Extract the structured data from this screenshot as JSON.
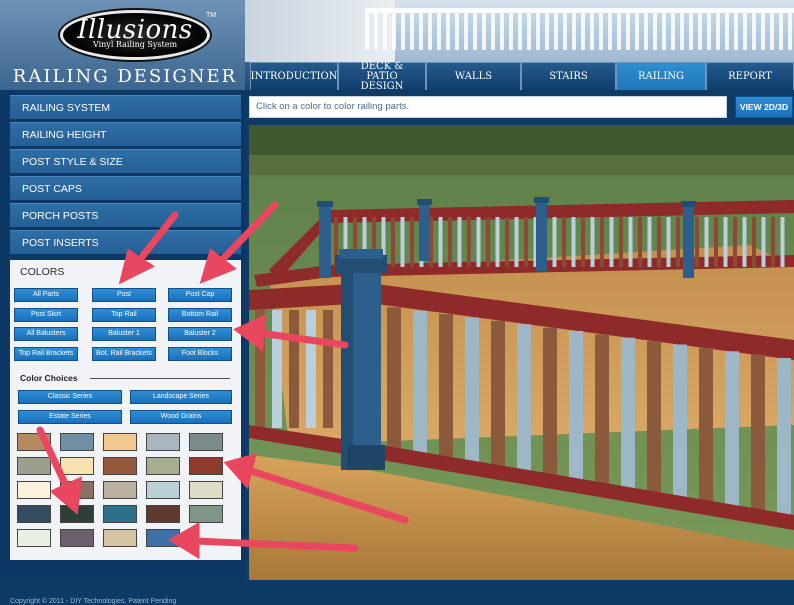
{
  "logo": {
    "title": "Illusions",
    "subtitle": "Vinyl Railing System",
    "tm": "TM"
  },
  "app_title": "RAILING DESIGNER",
  "tabs": [
    {
      "label": "INTRODUCTION"
    },
    {
      "label": "DECK & PATIO DESIGN"
    },
    {
      "label": "WALLS"
    },
    {
      "label": "STAIRS"
    },
    {
      "label": "RAILING"
    },
    {
      "label": "REPORT"
    }
  ],
  "active_tab": "RAILING",
  "sidebar": {
    "items": [
      {
        "label": "RAILING SYSTEM"
      },
      {
        "label": "RAILING HEIGHT"
      },
      {
        "label": "POST STYLE & SIZE"
      },
      {
        "label": "POST CAPS"
      },
      {
        "label": "PORCH POSTS"
      },
      {
        "label": "POST INSERTS"
      }
    ],
    "colors": {
      "heading": "COLORS",
      "parts": [
        "All Parts",
        "Post",
        "Post Cap",
        "Post Skirt",
        "Top Rail",
        "Bottom Rail",
        "All Balusters",
        "Baluster 1",
        "Baluster 2",
        "Top Rail Brackets",
        "Bot. Rail Brackets",
        "Foot Blocks"
      ],
      "choices_label": "Color Choices",
      "series": [
        "Classic Series",
        "Landscape Series",
        "Estate Series",
        "Wood Grains"
      ],
      "swatches": [
        "#b58a5e",
        "#6f8fa3",
        "#f4c98f",
        "#a8b6bf",
        "#7e8b8c",
        "#9aa08c",
        "#f8e2b0",
        "#97583c",
        "#a7ae8f",
        "#8c3b2c",
        "#fbf1dc",
        "#8a7164",
        "#b9b0a2",
        "#b9d1d4",
        "#dcdcc7",
        "#334c62",
        "#2f3e36",
        "#2e6f8d",
        "#5f3a2f",
        "#7f9586",
        "#e8efe3",
        "#6a5f6a",
        "#d4c4a4",
        "#3d6fa8"
      ]
    },
    "copyright": "Copyright © 2011 - DIY Technologies. Patent Pending"
  },
  "main": {
    "instruction": "Click on a color to color railing parts.",
    "view_button": "VIEW 2D/3D"
  },
  "colors": {
    "sidebar_bg": "#0d3764",
    "menu_item": "#2f6ea6",
    "button": "#1b6fbb",
    "active_tab": "#2f8fcf",
    "arrow": "#e8475f",
    "rail_red": "#8e2a2a",
    "post_blue": "#2d5f8d",
    "deck_wood": "#c9934f"
  }
}
